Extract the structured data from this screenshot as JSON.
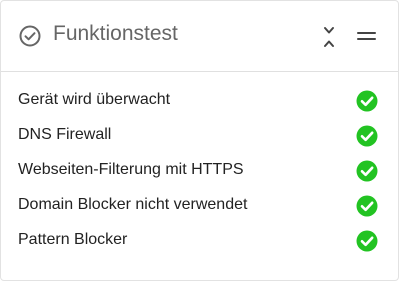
{
  "widget": {
    "title": "Funktionstest",
    "header_icon": "check-circle-outline-icon",
    "collapse_icon": "collapse-chevrons-icon",
    "menu_icon": "drag-handle-icon"
  },
  "checks": [
    {
      "label": "Gerät wird überwacht",
      "status": "ok"
    },
    {
      "label": "DNS Firewall",
      "status": "ok"
    },
    {
      "label": "Webseiten-Filterung mit HTTPS",
      "status": "ok"
    },
    {
      "label": "Domain Blocker nicht verwendet",
      "status": "ok"
    },
    {
      "label": "Pattern Blocker",
      "status": "ok"
    }
  ],
  "colors": {
    "ok": "#22c322",
    "title": "#666666",
    "text": "#222222",
    "border": "#e0e0e0"
  }
}
